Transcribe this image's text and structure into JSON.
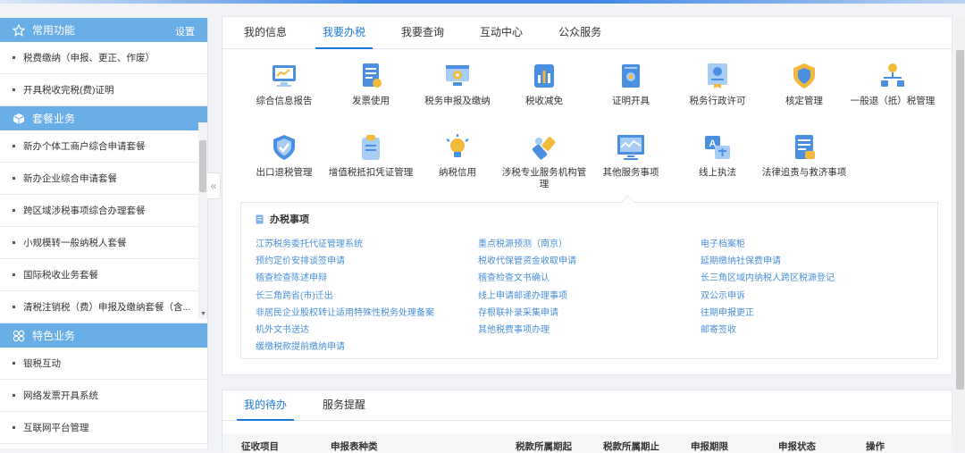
{
  "sidebar": {
    "sections": [
      {
        "title": "常用功能",
        "icon": "star-icon",
        "settings_label": "设置",
        "items": [
          "税费缴纳（申报、更正、作废）",
          "开具税收完税(费)证明"
        ]
      },
      {
        "title": "套餐业务",
        "icon": "cube-icon",
        "items": [
          "新办个体工商户综合申请套餐",
          "新办企业综合申请套餐",
          "跨区域涉税事项综合办理套餐",
          "小规模转一般纳税人套餐",
          "国际税收业务套餐",
          "清税注销税（费）申报及缴纳套餐（含..."
        ]
      },
      {
        "title": "特色业务",
        "icon": "grid-icon",
        "items": [
          "银税互动",
          "网络发票开具系统",
          "互联网平台管理"
        ]
      }
    ]
  },
  "tabs": [
    {
      "label": "我的信息",
      "active": false
    },
    {
      "label": "我要办税",
      "active": true
    },
    {
      "label": "我要查询",
      "active": false
    },
    {
      "label": "互动中心",
      "active": false
    },
    {
      "label": "公众服务",
      "active": false
    }
  ],
  "services": [
    {
      "label": "综合信息报告",
      "icon": "monitor-chart-icon"
    },
    {
      "label": "发票使用",
      "icon": "invoice-icon"
    },
    {
      "label": "税务申报及缴纳",
      "icon": "monitor-gear-icon"
    },
    {
      "label": "税收减免",
      "icon": "bar-chart-icon"
    },
    {
      "label": "证明开具",
      "icon": "certificate-icon"
    },
    {
      "label": "税务行政许可",
      "icon": "license-icon"
    },
    {
      "label": "核定管理",
      "icon": "shield-icon"
    },
    {
      "label": "一般退（抵）税管理",
      "icon": "network-icon"
    },
    {
      "label": "出口退税管理",
      "icon": "shield-check-icon"
    },
    {
      "label": "增值税抵扣凭证管理",
      "icon": "clipboard-icon"
    },
    {
      "label": "纳税信用",
      "icon": "lightbulb-icon"
    },
    {
      "label": "涉税专业服务机构管理",
      "icon": "tools-icon"
    },
    {
      "label": "其他服务事项",
      "icon": "monitor-wave-icon",
      "active": true
    },
    {
      "label": "线上执法",
      "icon": "translate-icon"
    },
    {
      "label": "法律追责与救济事项",
      "icon": "document-icon"
    }
  ],
  "panel": {
    "title": "办税事项",
    "links": [
      "江苏税务委托代征管理系统",
      "重点税源预测（南京）",
      "电子档案柜",
      "预约定价安排谈签申请",
      "税收代保管资金收取申请",
      "延期缴纳社保费申请",
      "稽查检查陈述申辩",
      "稽查检查文书确认",
      "长三角区域内纳税人跨区税源登记",
      "长三角跨省(市)迁出",
      "线上申请邮递办理事项",
      "双公示申诉",
      "非居民企业股权转让适用特殊性税务处理备案",
      "存根联补录采集申请",
      "往期申报更正",
      "机外文书送达",
      "其他税费事项办理",
      "邮寄签收",
      "缓缴税款提前缴纳申请"
    ]
  },
  "bottom": {
    "tabs": [
      {
        "label": "我的待办",
        "active": true
      },
      {
        "label": "服务提醒",
        "active": false
      }
    ],
    "columns": [
      "征收项目",
      "申报表种类",
      "税款所属期起",
      "税款所属期止",
      "申报期限",
      "申报状态",
      "操作"
    ]
  }
}
